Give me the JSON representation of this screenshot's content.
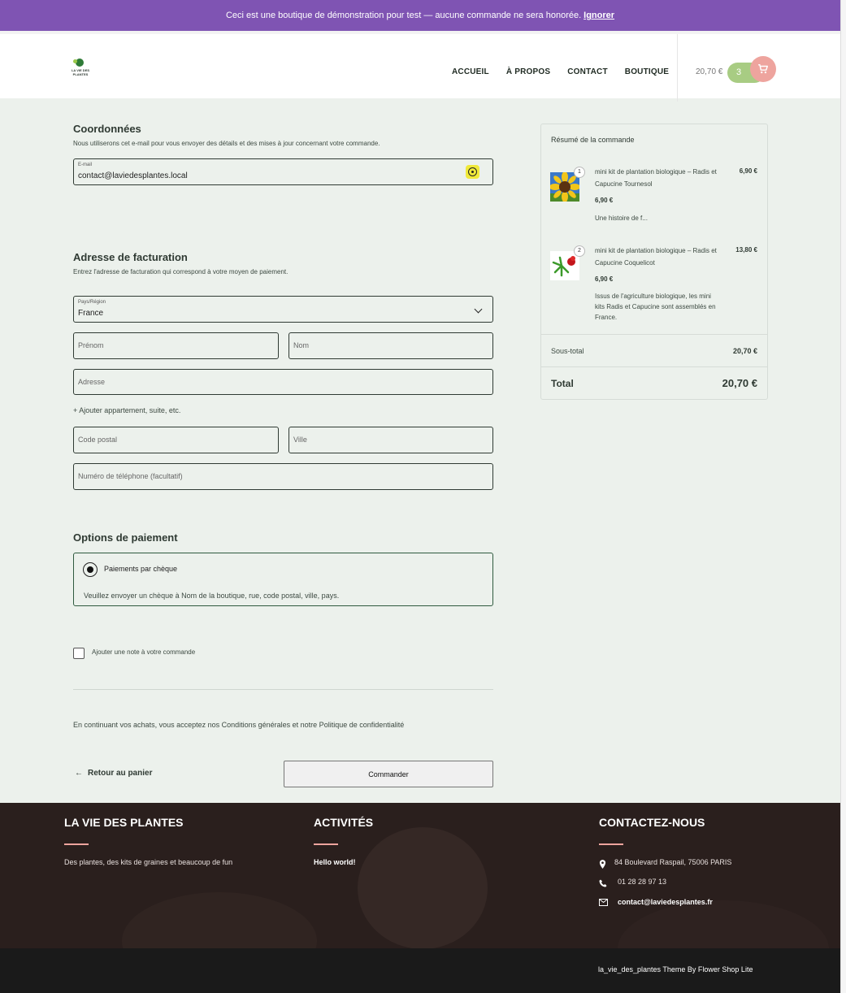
{
  "banner": {
    "text": "Ceci est une boutique de démonstration pour test — aucune commande ne sera honorée.",
    "dismiss": "Ignorer"
  },
  "header": {
    "logo_text": "LA VIE DES PLANTES",
    "nav": [
      "ACCUEIL",
      "À PROPOS",
      "CONTACT",
      "BOUTIQUE"
    ],
    "cart_total": "20,70 €",
    "cart_count": "3"
  },
  "contact": {
    "title": "Coordonnées",
    "desc": "Nous utiliserons cet e-mail pour vous envoyer des détails et des mises à jour concernant votre commande.",
    "email_label": "E-mail",
    "email_value": "contact@laviedesplantes.local"
  },
  "billing": {
    "title": "Adresse de facturation",
    "desc": "Entrez l'adresse de facturation qui correspond à votre moyen de paiement.",
    "country_label": "Pays/Région",
    "country_value": "France",
    "first_name": "Prénom",
    "last_name": "Nom",
    "address": "Adresse",
    "add_apartment": "+ Ajouter appartement, suite, etc.",
    "postcode": "Code postal",
    "city": "Ville",
    "phone": "Numéro de téléphone (facultatif)"
  },
  "payment": {
    "title": "Options de paiement",
    "method": "Paiements par chèque",
    "description": "Veuillez envoyer un chèque à Nom de la boutique, rue, code postal, ville, pays."
  },
  "note_label": "Ajouter une note à votre commande",
  "terms": "En continuant vos achats, vous acceptez nos Conditions générales et notre Politique de confidentialité",
  "back_label": "Retour au panier",
  "order_button": "Commander",
  "summary": {
    "title": "Résumé de la commande",
    "items": [
      {
        "qty": "1",
        "name": "mini kit de plantation biologique – Radis et Capucine Tournesol",
        "price": "6,90 €",
        "unit_price": "6,90 €",
        "desc": "Une histoire de f..."
      },
      {
        "qty": "2",
        "name": "mini kit de plantation biologique – Radis et Capucine Coquelicot",
        "price": "13,80 €",
        "unit_price": "6,90 €",
        "desc": "Issus de l'agriculture biologique, les mini kits Radis et Capucine sont assemblés en France."
      }
    ],
    "subtotal_label": "Sous-total",
    "subtotal": "20,70 €",
    "total_label": "Total",
    "total": "20,70 €"
  },
  "footer": {
    "col1_title": "LA VIE DES PLANTES",
    "col1_text": "Des plantes, des kits de graines et beaucoup de fun",
    "col2_title": "ACTIVITÉS",
    "col2_link": "Hello world!",
    "col3_title": "CONTACTEZ-NOUS",
    "address": "84 Boulevard Raspail, 75006 PARIS",
    "phone": "01 28 28 97 13",
    "email": "contact@laviedesplantes.fr",
    "credit": "la_vie_des_plantes Theme By Flower Shop Lite"
  },
  "colors": {
    "banner": "#7f54b3",
    "page_bg": "#ecf1ec",
    "accent_pink": "#eea49e",
    "accent_green": "#a8cc83",
    "footer_bg": "#2a1f1d"
  }
}
